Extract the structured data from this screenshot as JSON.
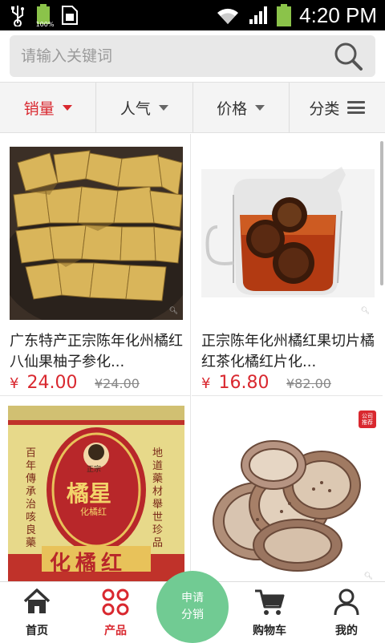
{
  "status_bar": {
    "time": "4:20 PM",
    "battery_label": "100%",
    "icons": [
      "usb-icon",
      "battery-icon",
      "sim-card-icon",
      "wifi-icon",
      "signal-icon",
      "battery-icon"
    ]
  },
  "search": {
    "placeholder": "请输入关键词",
    "value": ""
  },
  "filters": [
    {
      "label": "销量",
      "active": true
    },
    {
      "label": "人气",
      "active": false
    },
    {
      "label": "价格",
      "active": false
    },
    {
      "label": "分类",
      "active": false
    }
  ],
  "products": [
    {
      "title": "广东特产正宗陈年化州橘红八仙果柚子参化...",
      "price": "24.00",
      "currency": "¥",
      "old_price": "¥24.00"
    },
    {
      "title": "正宗陈年化州橘红果切片橘红茶化橘红片化...",
      "price": "16.80",
      "currency": "¥",
      "old_price": "¥82.00"
    },
    {
      "title": "",
      "price": "",
      "currency": "",
      "old_price": "",
      "tin_text": {
        "brand": "橘星",
        "sub": "化橘红",
        "product": "化橘红",
        "left": "百年傳承治咳良藥",
        "right": "地道藥材舉世珍品",
        "top": "正宗"
      }
    },
    {
      "title": "",
      "price": "",
      "currency": "",
      "old_price": "",
      "badge": "公司推荐"
    }
  ],
  "bottom_nav": [
    {
      "label": "首页",
      "icon": "home-icon"
    },
    {
      "label": "产品",
      "icon": "grid-icon",
      "active": true
    },
    {
      "label": "购物车",
      "icon": "cart-icon"
    },
    {
      "label": "我的",
      "icon": "user-icon"
    }
  ],
  "fab": {
    "line1": "申请",
    "line2": "分销"
  },
  "colors": {
    "accent": "#d9282f",
    "fab": "#71cb93"
  }
}
